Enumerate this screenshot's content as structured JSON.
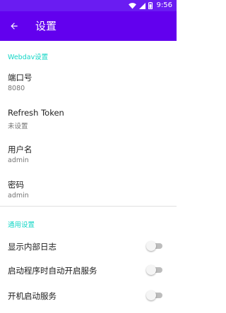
{
  "status_bar": {
    "time": "9:56",
    "icons": [
      "wifi-icon",
      "cellular-signal-icon",
      "battery-icon"
    ],
    "color": "#6a1cf2"
  },
  "app_bar": {
    "title": "设置",
    "back_icon": "arrow-back-icon",
    "color": "#6200ee"
  },
  "accent_color": "#13d6c6",
  "webdav": {
    "category": "Webdav设置",
    "items": [
      {
        "title": "端口号",
        "summary": "8080"
      },
      {
        "title": "Refresh Token",
        "summary": "未设置"
      },
      {
        "title": "用户名",
        "summary": "admin"
      },
      {
        "title": "密码",
        "summary": "admin"
      }
    ]
  },
  "general": {
    "category": "通用设置",
    "items": [
      {
        "title": "显示内部日志",
        "enabled": false
      },
      {
        "title": "启动程序时自动开启服务",
        "enabled": false
      },
      {
        "title": "开机启动服务",
        "enabled": false
      }
    ]
  }
}
